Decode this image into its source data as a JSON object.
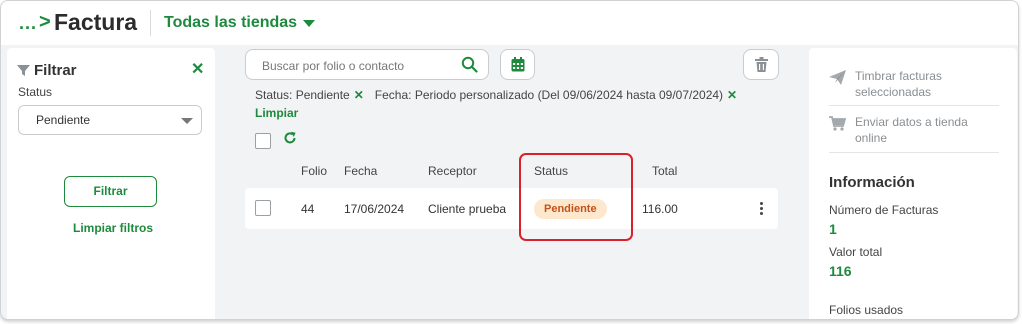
{
  "breadcrumb": {
    "dots": "...",
    "separator": ">"
  },
  "header": {
    "title": "Factura",
    "store_selector": "Todas las tiendas"
  },
  "filter_panel": {
    "title": "Filtrar",
    "close": "✕",
    "status_label": "Status",
    "status_value": "Pendiente",
    "apply_button": "Filtrar",
    "clear_link": "Limpiar filtros"
  },
  "search": {
    "placeholder": "Buscar por folio o contacto"
  },
  "active_filters": {
    "status": "Status: Pendiente",
    "fecha": "Fecha: Periodo personalizado (Del 09/06/2024 hasta 09/07/2024)",
    "remove": "✕",
    "clear": "Limpiar"
  },
  "table": {
    "headers": {
      "folio": "Folio",
      "fecha": "Fecha",
      "receptor": "Receptor",
      "status": "Status",
      "total": "Total"
    },
    "rows": [
      {
        "folio": "44",
        "fecha": "17/06/2024",
        "receptor": "Cliente prueba",
        "status": "Pendiente",
        "total": "116.00"
      }
    ]
  },
  "actions": {
    "timbrar": "Timbrar facturas seleccionadas",
    "enviar": "Enviar datos a tienda online"
  },
  "info": {
    "title": "Información",
    "count_label": "Número de Facturas",
    "count_value": "1",
    "total_label": "Valor total",
    "total_value": "116",
    "folios_label": "Folios usados"
  },
  "colors": {
    "accent": "#1e8a3e",
    "badge_bg": "#fde7cd",
    "badge_text": "#c4521a",
    "highlight": "#d9212c"
  },
  "icons": [
    "search-icon",
    "calendar-icon",
    "trash-icon",
    "filter-icon",
    "refresh-icon",
    "send-icon",
    "cart-icon",
    "kebab-icon",
    "caret-down-icon"
  ]
}
